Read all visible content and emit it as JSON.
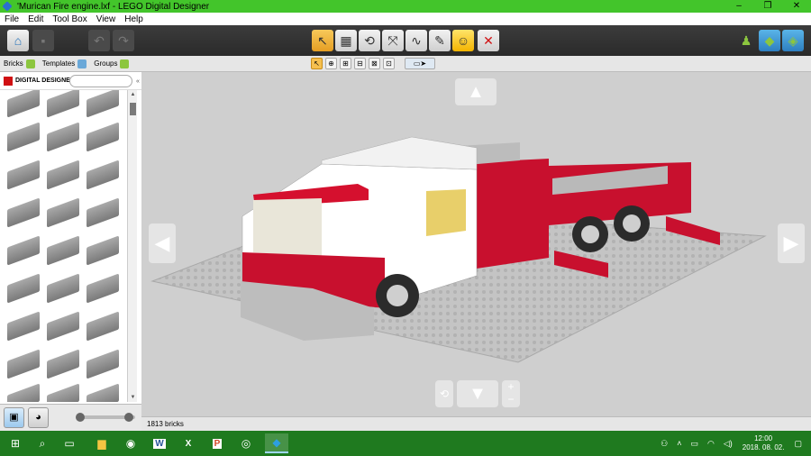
{
  "window": {
    "title": "'Murican Fire engine.lxf - LEGO Digital Designer",
    "buttons": [
      "–",
      "❐",
      "✕"
    ]
  },
  "menu": [
    "File",
    "Edit",
    "Tool Box",
    "View",
    "Help"
  ],
  "toolbar": {
    "home_icon": "home-icon",
    "tools": [
      {
        "name": "select-tool",
        "glyph": "↖",
        "active": true
      },
      {
        "name": "clone-tool",
        "glyph": "▦",
        "active": false
      },
      {
        "name": "hinge-tool",
        "glyph": "⟲",
        "active": false
      },
      {
        "name": "hinge-align-tool",
        "glyph": "⤧",
        "active": false
      },
      {
        "name": "flex-tool",
        "glyph": "∿",
        "active": false
      },
      {
        "name": "paint-tool",
        "glyph": "✎",
        "active": false
      },
      {
        "name": "decoration-tool",
        "glyph": "☺",
        "active": false
      },
      {
        "name": "delete-tool",
        "glyph": "✕",
        "active": false
      }
    ],
    "right": [
      "build-mode-icon",
      "view-mode-icon",
      "instructions-mode-icon"
    ]
  },
  "tabs": [
    {
      "label": "Bricks",
      "icon": "bricks-icon"
    },
    {
      "label": "Templates",
      "icon": "templates-icon"
    },
    {
      "label": "Groups",
      "icon": "groups-icon"
    }
  ],
  "palette": {
    "logo_text": "DIGITAL DESIGNER",
    "search_placeholder": ""
  },
  "subtools": [
    "↖",
    "⊕",
    "⊞",
    "⊟",
    "⊠",
    "⊡"
  ],
  "viewport": {
    "arrows": {
      "up": "▲",
      "down": "▼",
      "left": "◀",
      "right": "▶",
      "zoom_in": "+",
      "zoom_out": "−",
      "reset": "⟲"
    }
  },
  "status": {
    "brick_count": "1813 bricks"
  },
  "taskbar": {
    "time": "12:00",
    "date": "2018. 08. 02.",
    "apps": [
      "start-icon",
      "search-icon",
      "task-view-icon",
      "file-explorer-icon",
      "chrome-icon",
      "word-icon",
      "excel-icon",
      "powerpoint-icon",
      "target-icon",
      "lego-designer-icon"
    ]
  }
}
